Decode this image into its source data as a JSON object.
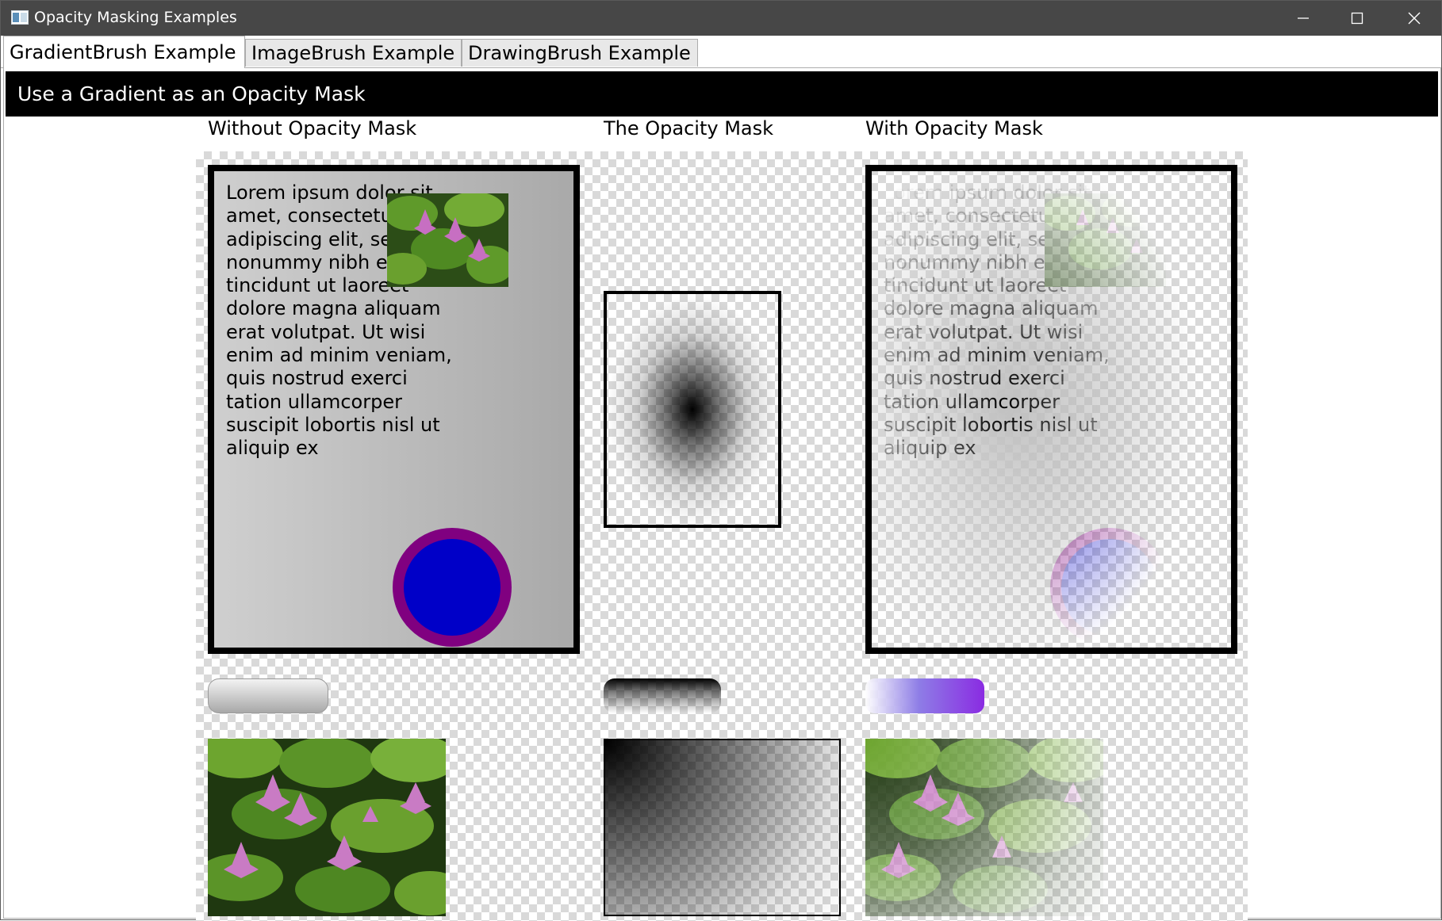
{
  "window": {
    "title": "Opacity Masking Examples",
    "controls": {
      "minimize_icon": "minimize-icon",
      "maximize_icon": "maximize-icon",
      "close_icon": "close-icon"
    }
  },
  "tabs": [
    {
      "label": "GradientBrush Example",
      "selected": true
    },
    {
      "label": "ImageBrush Example",
      "selected": false
    },
    {
      "label": "DrawingBrush Example",
      "selected": false
    }
  ],
  "header": {
    "title": "Use a Gradient as an Opacity Mask"
  },
  "columns": {
    "without": "Without Opacity Mask",
    "mask": "The Opacity Mask",
    "with": "With Opacity Mask"
  },
  "sample_text": "Lorem ipsum dolor sit amet, consectetuer adipiscing elit, sed diam nonummy nibh euismod tincidunt ut laoreet dolore magna aliquam erat volutpat. Ut wisi enim ad minim veniam, quis nostrud exerci tation ullamcorper suscipit lobortis nisl ut aliquip ex",
  "colors": {
    "titlebar": "#474747",
    "header_bar": "#000000",
    "circle_fill": "#0000c8",
    "circle_stroke": "#800080",
    "purple_button": "#8a2be2"
  }
}
